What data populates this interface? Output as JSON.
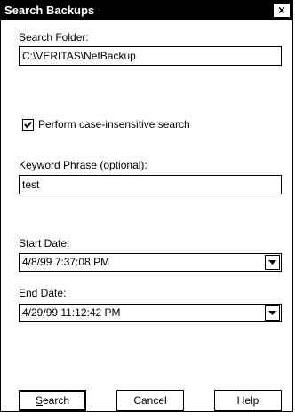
{
  "window": {
    "title": "Search Backups",
    "close_glyph": "×"
  },
  "search_folder": {
    "label": "Search Folder:",
    "value": "C:\\VERITAS\\NetBackup"
  },
  "case_insensitive": {
    "label": "Perform case-insensitive search",
    "checked": true
  },
  "keyword": {
    "label": "Keyword Phrase (optional):",
    "value": "test"
  },
  "start_date": {
    "label": "Start Date:",
    "value": "4/8/99 7:37:08 PM"
  },
  "end_date": {
    "label": "End Date:",
    "value": "4/29/99 11:12:42 PM"
  },
  "buttons": {
    "search_mnemonic": "S",
    "search_rest": "earch",
    "cancel": "Cancel",
    "help": "Help"
  }
}
